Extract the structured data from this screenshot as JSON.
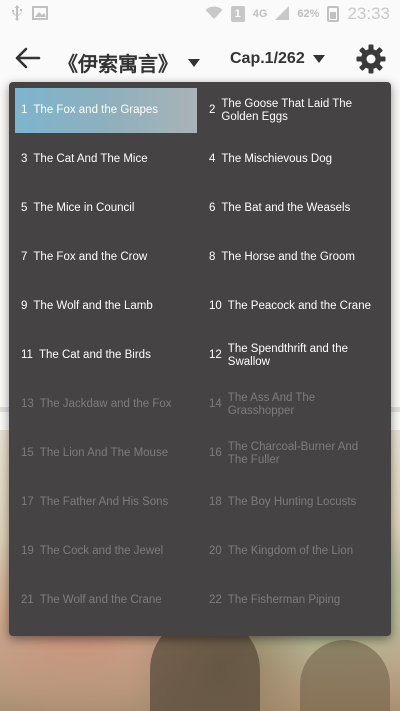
{
  "status_bar": {
    "network_type": "4G",
    "sim_label": "1",
    "battery_percent": "62%",
    "time": "23:33",
    "icons": [
      "usb-icon",
      "image-icon",
      "wifi-icon",
      "signal-icon",
      "battery-charging-icon"
    ]
  },
  "toolbar": {
    "book_title": "《伊索寓言》",
    "chapter_label": "Cap.1/262"
  },
  "chapters": [
    {
      "num": "1",
      "title": "The Fox and the Grapes",
      "selected": true,
      "enabled": true
    },
    {
      "num": "2",
      "title": "The Goose That Laid The Golden Eggs",
      "selected": false,
      "enabled": true
    },
    {
      "num": "3",
      "title": "The Cat And The Mice",
      "selected": false,
      "enabled": true
    },
    {
      "num": "4",
      "title": "The Mischievous Dog",
      "selected": false,
      "enabled": true
    },
    {
      "num": "5",
      "title": "The Mice in Council",
      "selected": false,
      "enabled": true
    },
    {
      "num": "6",
      "title": "The Bat and the Weasels",
      "selected": false,
      "enabled": true
    },
    {
      "num": "7",
      "title": "The Fox and the Crow",
      "selected": false,
      "enabled": true
    },
    {
      "num": "8",
      "title": "The Horse and the Groom",
      "selected": false,
      "enabled": true
    },
    {
      "num": "9",
      "title": "The Wolf and the Lamb",
      "selected": false,
      "enabled": true
    },
    {
      "num": "10",
      "title": "The Peacock and the Crane",
      "selected": false,
      "enabled": true
    },
    {
      "num": "11",
      "title": "The Cat and the Birds",
      "selected": false,
      "enabled": true
    },
    {
      "num": "12",
      "title": "The Spendthrift and the Swallow",
      "selected": false,
      "enabled": true
    },
    {
      "num": "13",
      "title": "The Jackdaw and the Fox",
      "selected": false,
      "enabled": false
    },
    {
      "num": "14",
      "title": "The Ass And The Grasshopper",
      "selected": false,
      "enabled": false
    },
    {
      "num": "15",
      "title": "The Lion And The Mouse",
      "selected": false,
      "enabled": false
    },
    {
      "num": "16",
      "title": "The Charcoal-Burner And The Fuller",
      "selected": false,
      "enabled": false
    },
    {
      "num": "17",
      "title": "The Father And His Sons",
      "selected": false,
      "enabled": false
    },
    {
      "num": "18",
      "title": "The Boy Hunting Locusts",
      "selected": false,
      "enabled": false
    },
    {
      "num": "19",
      "title": "The Cock and the Jewel",
      "selected": false,
      "enabled": false
    },
    {
      "num": "20",
      "title": "The Kingdom of the Lion",
      "selected": false,
      "enabled": false
    },
    {
      "num": "21",
      "title": "The Wolf and the Crane",
      "selected": false,
      "enabled": false
    },
    {
      "num": "22",
      "title": "The Fisherman Piping",
      "selected": false,
      "enabled": false
    }
  ],
  "colors": {
    "menu_background": "#454344",
    "selected_highlight": "#7db4ce",
    "disabled_text": "#7e7c7d",
    "enabled_text": "#ffffff"
  }
}
